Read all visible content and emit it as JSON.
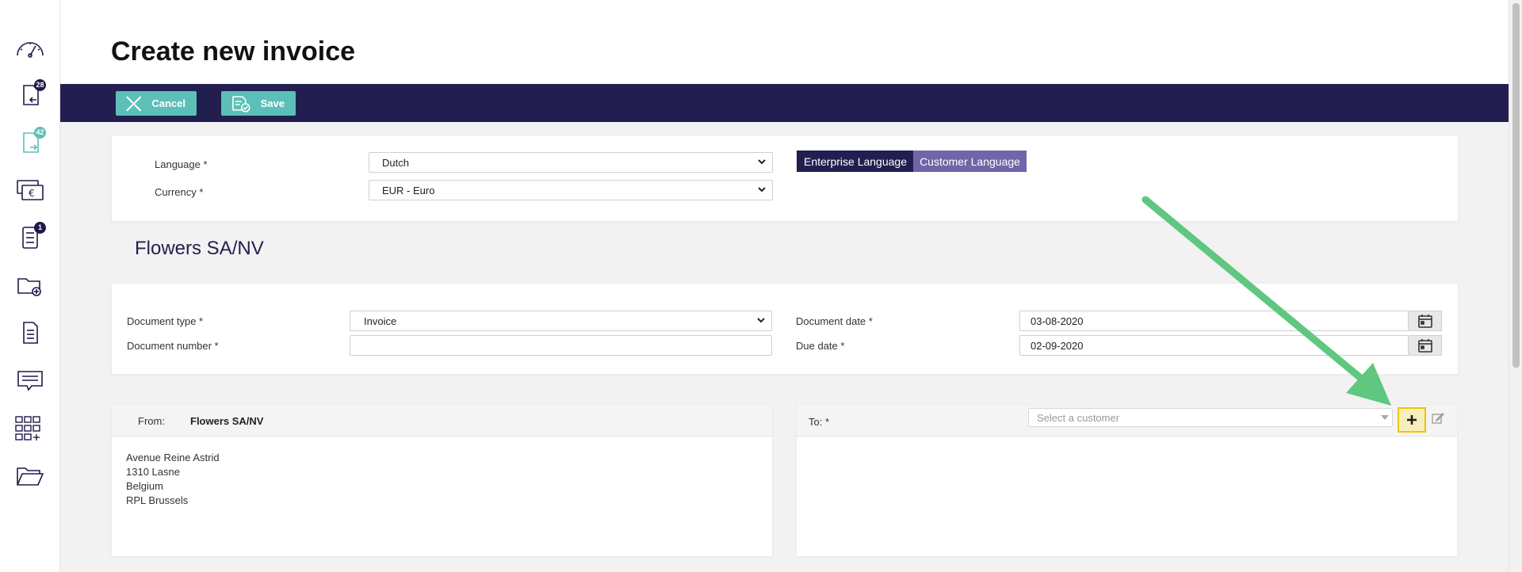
{
  "page": {
    "title": "Create new invoice"
  },
  "sidebar": {
    "items": [
      {
        "name": "dashboard-icon",
        "badge": ""
      },
      {
        "name": "incoming-documents-icon",
        "badge": "28"
      },
      {
        "name": "outgoing-documents-icon",
        "badge": "42"
      },
      {
        "name": "payments-icon",
        "badge": ""
      },
      {
        "name": "tasks-icon",
        "badge": "1"
      },
      {
        "name": "add-folder-icon",
        "badge": ""
      },
      {
        "name": "document-icon",
        "badge": ""
      },
      {
        "name": "messages-icon",
        "badge": ""
      },
      {
        "name": "apps-icon",
        "badge": ""
      },
      {
        "name": "folder-icon",
        "badge": ""
      }
    ]
  },
  "toolbar": {
    "cancel_label": "Cancel",
    "save_label": "Save"
  },
  "settings": {
    "language_label": "Language *",
    "language_value": "Dutch",
    "currency_label": "Currency *",
    "currency_value": "EUR - Euro",
    "enterprise_language_label": "Enterprise Language",
    "customer_language_label": "Customer Language"
  },
  "company_name": "Flowers SA/NV",
  "document": {
    "type_label": "Document type *",
    "type_value": "Invoice",
    "number_label": "Document number *",
    "number_value": "",
    "date_label": "Document date *",
    "date_value": "03-08-2020",
    "due_label": "Due date *",
    "due_value": "02-09-2020"
  },
  "from": {
    "label": "From:",
    "name": "Flowers SA/NV",
    "address": [
      "Avenue Reine Astrid",
      "1310 Lasne",
      "Belgium",
      "RPL Brussels"
    ]
  },
  "to": {
    "label": "To: *",
    "customer_placeholder": "Select a customer"
  },
  "colors": {
    "navy": "#221f50",
    "teal": "#5cbfb8",
    "purple": "#6f65a8",
    "arrow_green": "#5fc77f",
    "highlight_yellow": "#f2c200"
  }
}
